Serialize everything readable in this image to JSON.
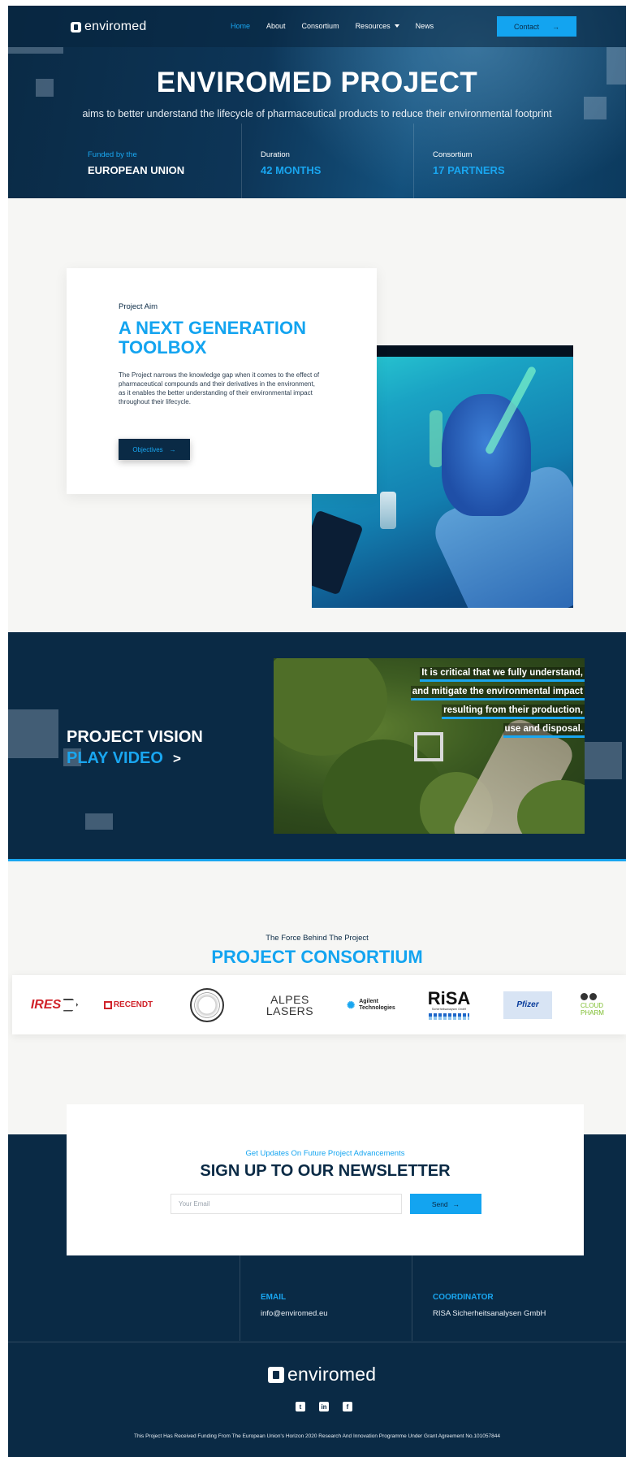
{
  "brand": {
    "name_prefix": "enviro",
    "name_suffix": "med"
  },
  "nav": {
    "items": [
      {
        "label": "Home",
        "active": true
      },
      {
        "label": "About"
      },
      {
        "label": "Consortium"
      },
      {
        "label": "Resources",
        "dropdown": true
      },
      {
        "label": "News"
      }
    ],
    "contact_label": "Contact",
    "arrow": "→"
  },
  "hero": {
    "title": "ENVIROMED PROJECT",
    "tagline": "aims to better understand the lifecycle of pharmaceutical products to reduce their environmental footprint",
    "stats": [
      {
        "label": "Funded by the",
        "value": "EUROPEAN UNION"
      },
      {
        "label": "Duration",
        "value": "42 MONTHS"
      },
      {
        "label": "Consortium",
        "value": "17 PARTNERS"
      }
    ]
  },
  "aim": {
    "kicker": "Project Aim",
    "title": "A NEXT GENERATION TOOLBOX",
    "body": "The Project narrows the knowledge gap when it comes to the effect of pharmaceutical compounds and their derivatives in the environment, as it enables the better understanding of their environmental impact throughout their lifecycle.",
    "button_label": "Objectives",
    "arrow": "→"
  },
  "vision": {
    "title": "PROJECT VISION",
    "play_label": "PLAY VIDEO",
    "play_glyph": ">",
    "quote_lines": [
      "It is critical that we fully understand,",
      "and mitigate the environmental impact",
      "resulting from their production,",
      "use and disposal."
    ]
  },
  "consortium": {
    "kicker": "The Force Behind The Project",
    "title": "PROJECT CONSORTIUM",
    "partners": {
      "ires": "IRES",
      "recendt": "RECENDT",
      "alpes_1": "ALPES",
      "alpes_2": "LASERS",
      "agilent_1": "Agilent",
      "agilent_2": "Technologies",
      "risa": "RiSA",
      "risa_sub": "Sicherheitsanalysen GmbH",
      "pfizer": "Pfizer",
      "cloud_1": "CLOUD",
      "cloud_2": "PHARM"
    }
  },
  "newsletter": {
    "kicker": "Get Updates On Future Project Advancements",
    "title": "SIGN UP TO OUR NEWSLETTER",
    "email_placeholder": "Your Email",
    "send_label": "Send",
    "arrow": "→"
  },
  "contact_info": [
    {
      "label": "EMAIL",
      "value": "info@enviromed.eu"
    },
    {
      "label": "COORDINATOR",
      "value": "RISA Sicherheitsanalysen GmbH"
    }
  ],
  "footer": {
    "social": [
      {
        "icon": "twitter-icon",
        "glyph": "t"
      },
      {
        "icon": "linkedin-icon",
        "glyph": "in"
      },
      {
        "icon": "facebook-icon",
        "glyph": "f"
      }
    ],
    "funding": "This Project Has Received Funding From The European Union's Horizon 2020 Research And Innovation Programme Under Grant Agreement No.101057844"
  },
  "colors": {
    "navy": "#0a2a45",
    "accent": "#13a4f0",
    "page_bg": "#f6f6f4"
  }
}
